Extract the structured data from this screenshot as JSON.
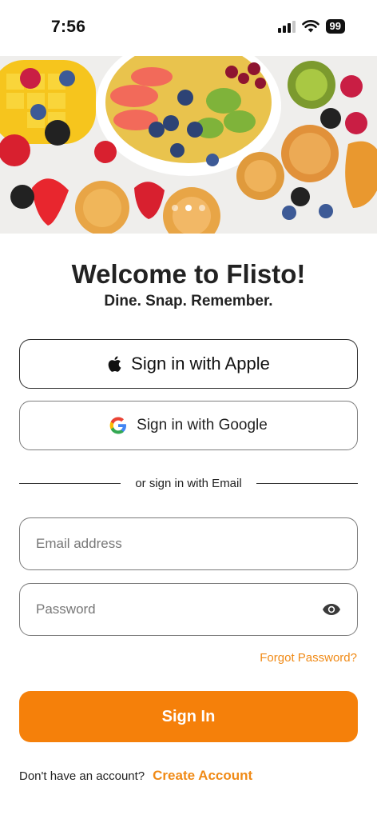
{
  "status_bar": {
    "time": "7:56",
    "battery": "99",
    "icons": [
      "signal-icon",
      "wifi-icon",
      "battery-icon"
    ]
  },
  "hero": {
    "image": "fruit-bowl-and-muffins-photo",
    "pager": {
      "count": 3,
      "active_index": 1
    }
  },
  "heading": {
    "title": "Welcome to Flisto!",
    "subtitle": "Dine. Snap. Remember."
  },
  "auth": {
    "apple_label": "Sign in with Apple",
    "apple_icon": "apple-logo-icon",
    "google_label": "Sign in with Google",
    "google_icon": "google-logo-icon",
    "divider_text": "or sign in with Email"
  },
  "form": {
    "email": {
      "placeholder": "Email address",
      "value": ""
    },
    "password": {
      "placeholder": "Password",
      "value": "",
      "toggle_icon": "eye-icon"
    },
    "forgot_label": "Forgot Password?",
    "submit_label": "Sign In"
  },
  "footer": {
    "prompt": "Don't have an account?",
    "link_label": "Create Account"
  },
  "colors": {
    "accent": "#f5800a",
    "link": "#f08a16",
    "text": "#222222",
    "border": "#7a7a7a"
  }
}
